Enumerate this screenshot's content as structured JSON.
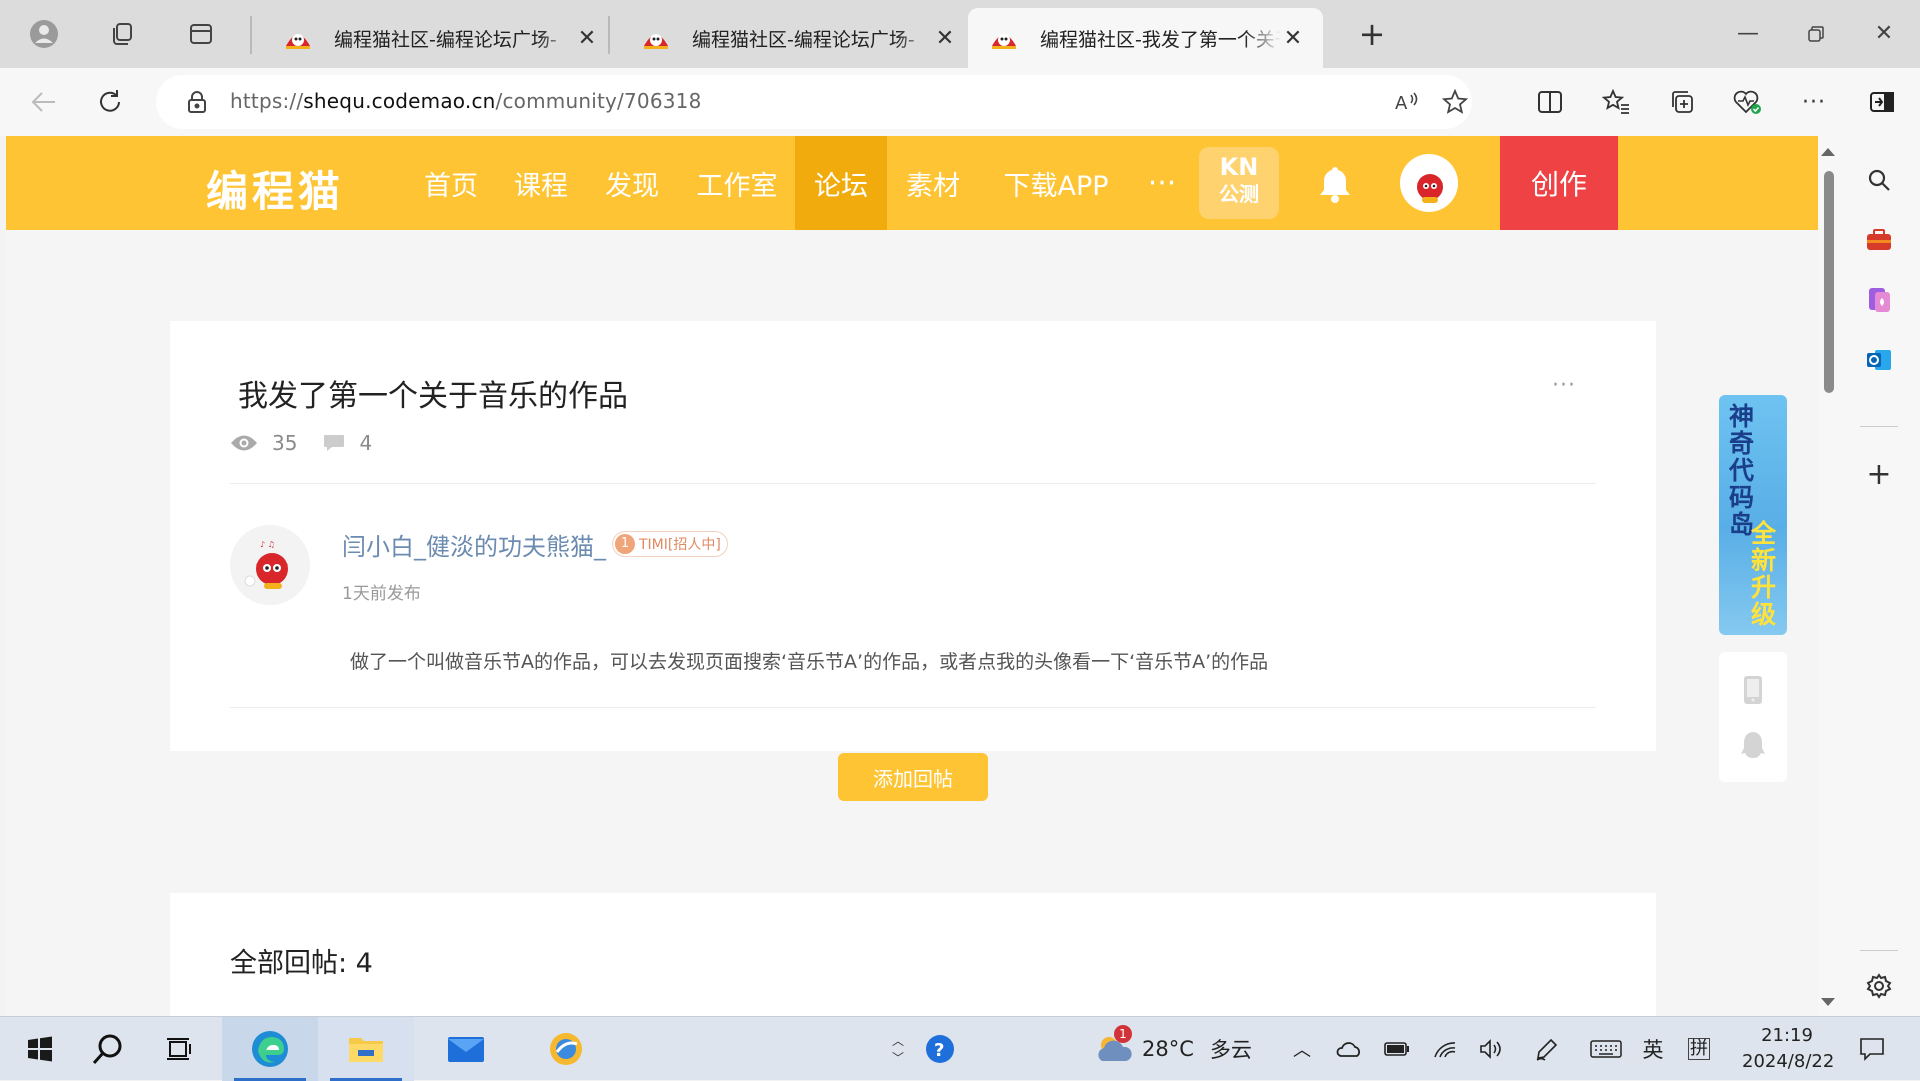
{
  "browser": {
    "tabs": [
      {
        "title": "编程猫社区-编程论坛广场-"
      },
      {
        "title": "编程猫社区-编程论坛广场-"
      },
      {
        "title": "编程猫社区-我发了第一个关于音乐的作品",
        "active": true
      }
    ],
    "url_prefix": "https://",
    "url_host": "shequ.codemao.cn",
    "url_path": "/community/706318"
  },
  "site": {
    "logo": "编程猫",
    "nav": [
      {
        "label": "首页"
      },
      {
        "label": "课程"
      },
      {
        "label": "发现"
      },
      {
        "label": "工作室"
      },
      {
        "label": "论坛",
        "active": true
      },
      {
        "label": "素材"
      },
      {
        "label": "下载APP"
      }
    ],
    "more": "···",
    "kn_top": "KN",
    "kn_bottom": "公测",
    "create": "创作"
  },
  "post": {
    "title": "我发了第一个关于音乐的作品",
    "views": "35",
    "comments": "4",
    "author": "闫小白_健淡的功夫熊猫_",
    "badge_level": "1",
    "badge_text": "TIMI[招人中]",
    "time": "1天前发布",
    "body": "做了一个叫做音乐节A的作品，可以去发现页面搜索‘音乐节A’的作品，或者点我的头像看一下‘音乐节A’的作品",
    "reply_button": "添加回帖",
    "more": "···"
  },
  "replies": {
    "title": "全部回帖: 4"
  },
  "promo": {
    "line1": "神奇代码岛",
    "line2": "全新升级"
  },
  "taskbar": {
    "weather_temp": "28°C",
    "weather_desc": "多云",
    "weather_alert": "1",
    "ime_lang": "英",
    "ime_mode": "拼",
    "time": "21:19",
    "date": "2024/8/22"
  },
  "colors": {
    "brand_yellow": "#fec433",
    "nav_active": "#f1ab0c",
    "create_red": "#ee4245",
    "author_link": "#6b8bb0"
  }
}
